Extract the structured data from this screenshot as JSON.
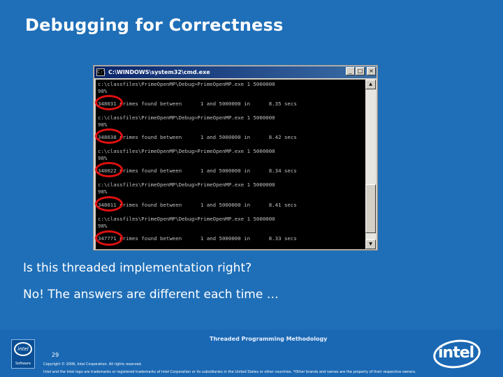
{
  "slide": {
    "title": "Debugging for Correctness",
    "question": "Is this threaded implementation right?",
    "answer": "No! The answers are different each time …"
  },
  "cmd_window": {
    "title": "C:\\WINDOWS\\system32\\cmd.exe",
    "buttons": {
      "minimize": "_",
      "maximize": "□",
      "close": "×"
    },
    "lines": [
      "c:\\classfiles\\PrimeOpenMP\\Debug>PrimeOpenMP.exe 1 5000000",
      "98%",
      "348031 primes found between      1 and 5000000 in      8.35 secs",
      "c:\\classfiles\\PrimeOpenMP\\Debug>PrimeOpenMP.exe 1 5000000",
      "98%",
      "348038 primes found between      1 and 5000000 in      8.42 secs",
      "c:\\classfiles\\PrimeOpenMP\\Debug>PrimeOpenMP.exe 1 5000000",
      "98%",
      "348022 primes found between      1 and 5000000 in      8.34 secs",
      "c:\\classfiles\\PrimeOpenMP\\Debug>PrimeOpenMP.exe 1 5000000",
      "98%",
      "348011 primes found between      1 and 5000000 in      8.41 secs",
      "c:\\classfiles\\PrimeOpenMP\\Debug>PrimeOpenMP.exe 1 5000000",
      "98%",
      "347771 primes found between      1 and 5000000 in      8.33 secs"
    ]
  },
  "footer": {
    "topic": "Threaded Programming Methodology",
    "page_number": "29",
    "copyright": "Copyright © 2006, Intel Corporation. All rights reserved.",
    "trademark": "Intel and the Intel logo are trademarks or registered trademarks of Intel Corporation or its subsidiaries in the United States or other countries. *Other brands and names are the property of their respective owners.",
    "badge_logo": "intel",
    "badge_label": "Software",
    "logo_text": "intel"
  },
  "colors": {
    "background": "#1f6fb8",
    "highlight_circle": "#e01010",
    "console_text": "#c0c0c0",
    "console_bg": "#000000"
  }
}
